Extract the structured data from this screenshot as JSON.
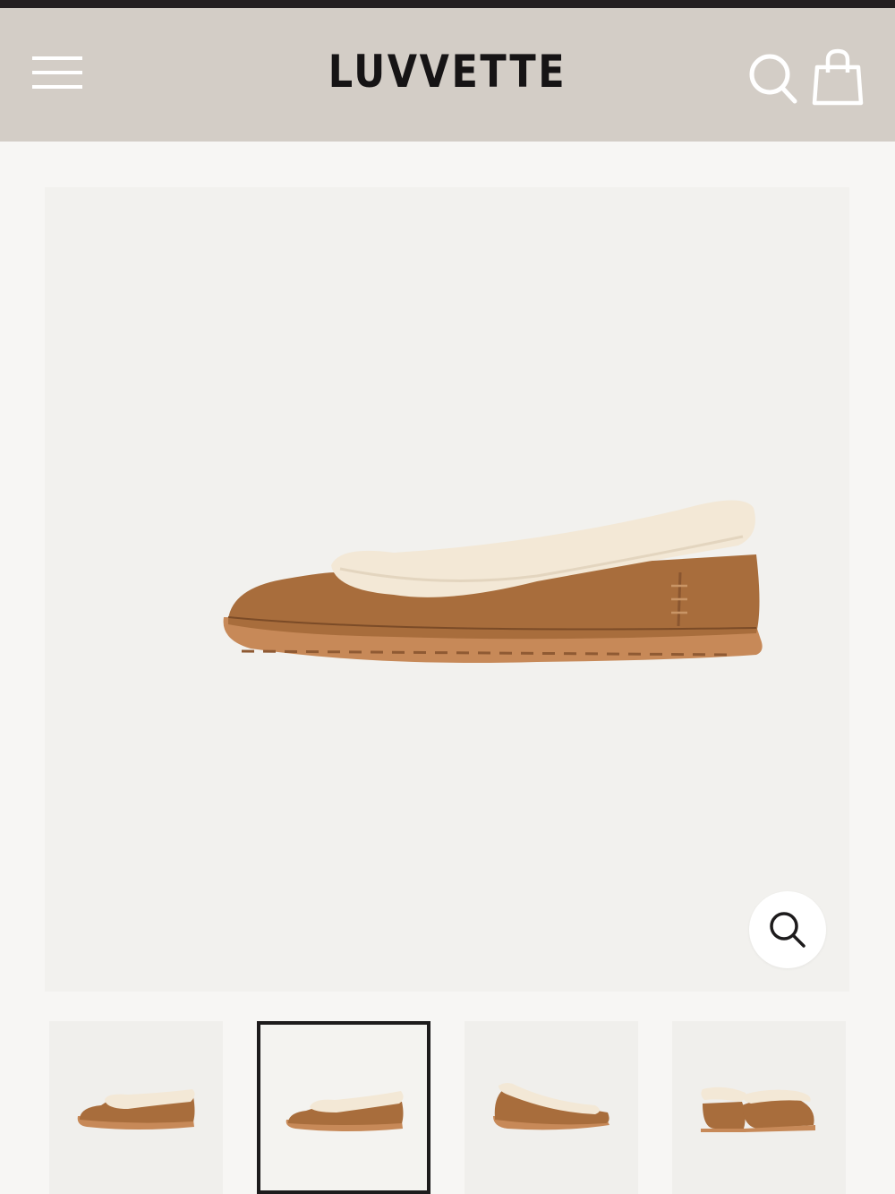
{
  "header": {
    "logo": "LUVVETTE",
    "menu_icon": "hamburger-menu-icon",
    "search_icon": "search-icon",
    "cart_icon": "shopping-bag-icon",
    "background": "#d3cdc6"
  },
  "product_gallery": {
    "zoom_icon": "zoom-magnifier-icon",
    "thumbnails": [
      {
        "view": "side-outer"
      },
      {
        "view": "side-inner",
        "selected": true
      },
      {
        "view": "three-quarter-front"
      },
      {
        "view": "back-pair"
      }
    ],
    "colors": {
      "suede": "#a86d3c",
      "shearling": "#f3e8d6",
      "sole": "#c78958"
    }
  }
}
